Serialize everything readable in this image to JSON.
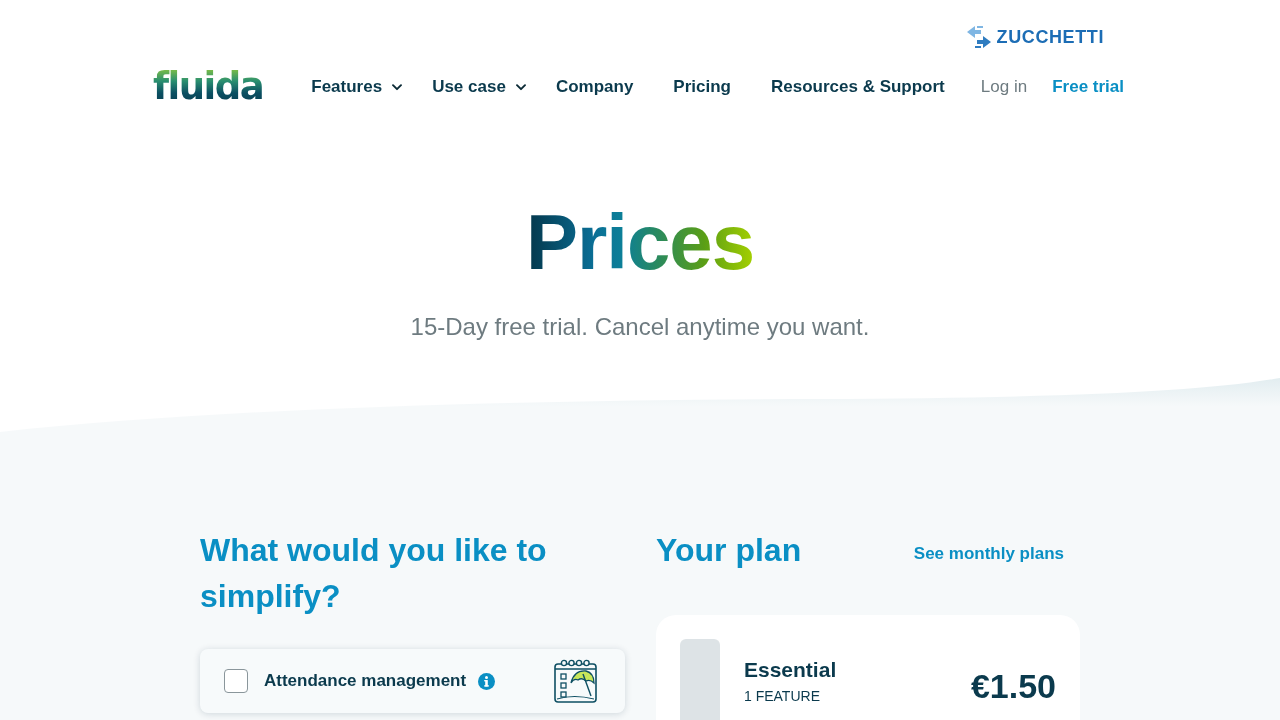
{
  "header": {
    "partner_logo": "ZUCCHETTI",
    "brand": "fluida",
    "nav": [
      {
        "label": "Features",
        "has_menu": true
      },
      {
        "label": "Use case",
        "has_menu": true
      },
      {
        "label": "Company",
        "has_menu": false
      },
      {
        "label": "Pricing",
        "has_menu": false
      },
      {
        "label": "Resources & Support",
        "has_menu": false
      }
    ],
    "login": "Log in",
    "cta": "Free trial"
  },
  "hero": {
    "title": "Prices",
    "subtitle": "15-Day free trial. Cancel anytime you want."
  },
  "simplify": {
    "title": "What would you like to simplify?",
    "features": [
      {
        "label": "Attendance management",
        "checked": false
      }
    ]
  },
  "plan": {
    "title": "Your plan",
    "link": "See monthly plans",
    "card": {
      "name": "Essential",
      "features": "1 FEATURE",
      "price": "€1.50"
    }
  }
}
